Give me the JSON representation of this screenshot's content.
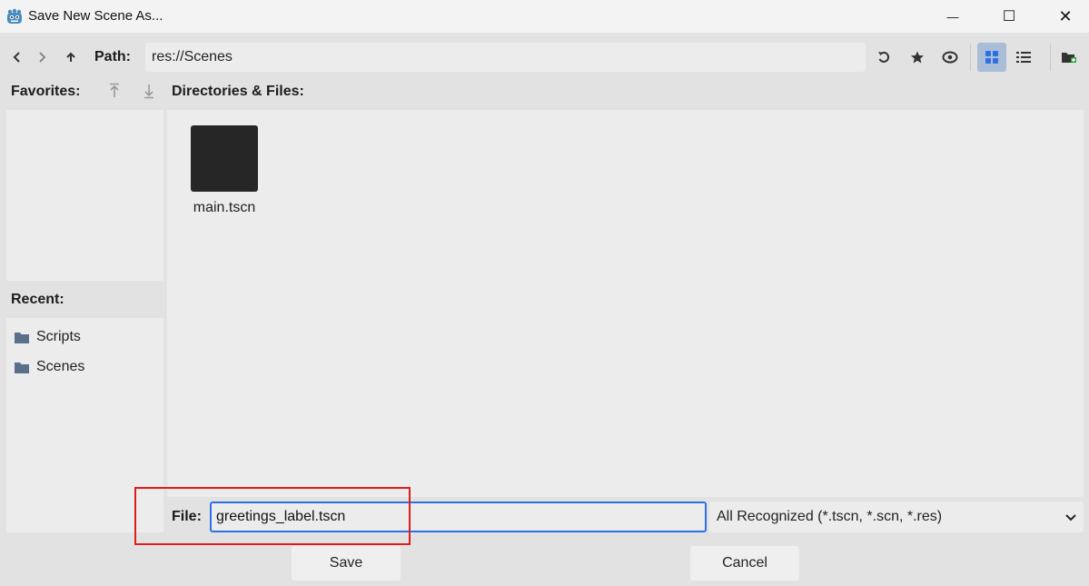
{
  "window": {
    "title": "Save New Scene As...",
    "minimize_symbol": "—",
    "maximize_symbol": "☐",
    "close_symbol": "✕"
  },
  "toolbar": {
    "path_label": "Path:",
    "path_value": "res://Scenes",
    "icons": [
      "chevron-left-icon",
      "chevron-right-icon",
      "arrow-up-icon",
      "refresh-icon",
      "star-icon",
      "eye-icon",
      "grid-view-icon",
      "list-view-icon",
      "new-folder-icon"
    ]
  },
  "favorites": {
    "label": "Favorites:",
    "items": []
  },
  "directories": {
    "label": "Directories & Files:",
    "files": [
      {
        "name": "main.tscn"
      }
    ]
  },
  "recent": {
    "label": "Recent:",
    "items": [
      {
        "label": "Scripts"
      },
      {
        "label": "Scenes"
      }
    ]
  },
  "file_bar": {
    "label": "File:",
    "value": "greetings_label.tscn",
    "filter_selected": "All Recognized (*.tscn, *.scn, *.res)"
  },
  "buttons": {
    "save": "Save",
    "cancel": "Cancel"
  },
  "colors": {
    "accent": "#2f6fe6",
    "highlight": "#e01b1b",
    "folder": "#5a6f8a",
    "active_toggle": "#a9bdd6"
  }
}
